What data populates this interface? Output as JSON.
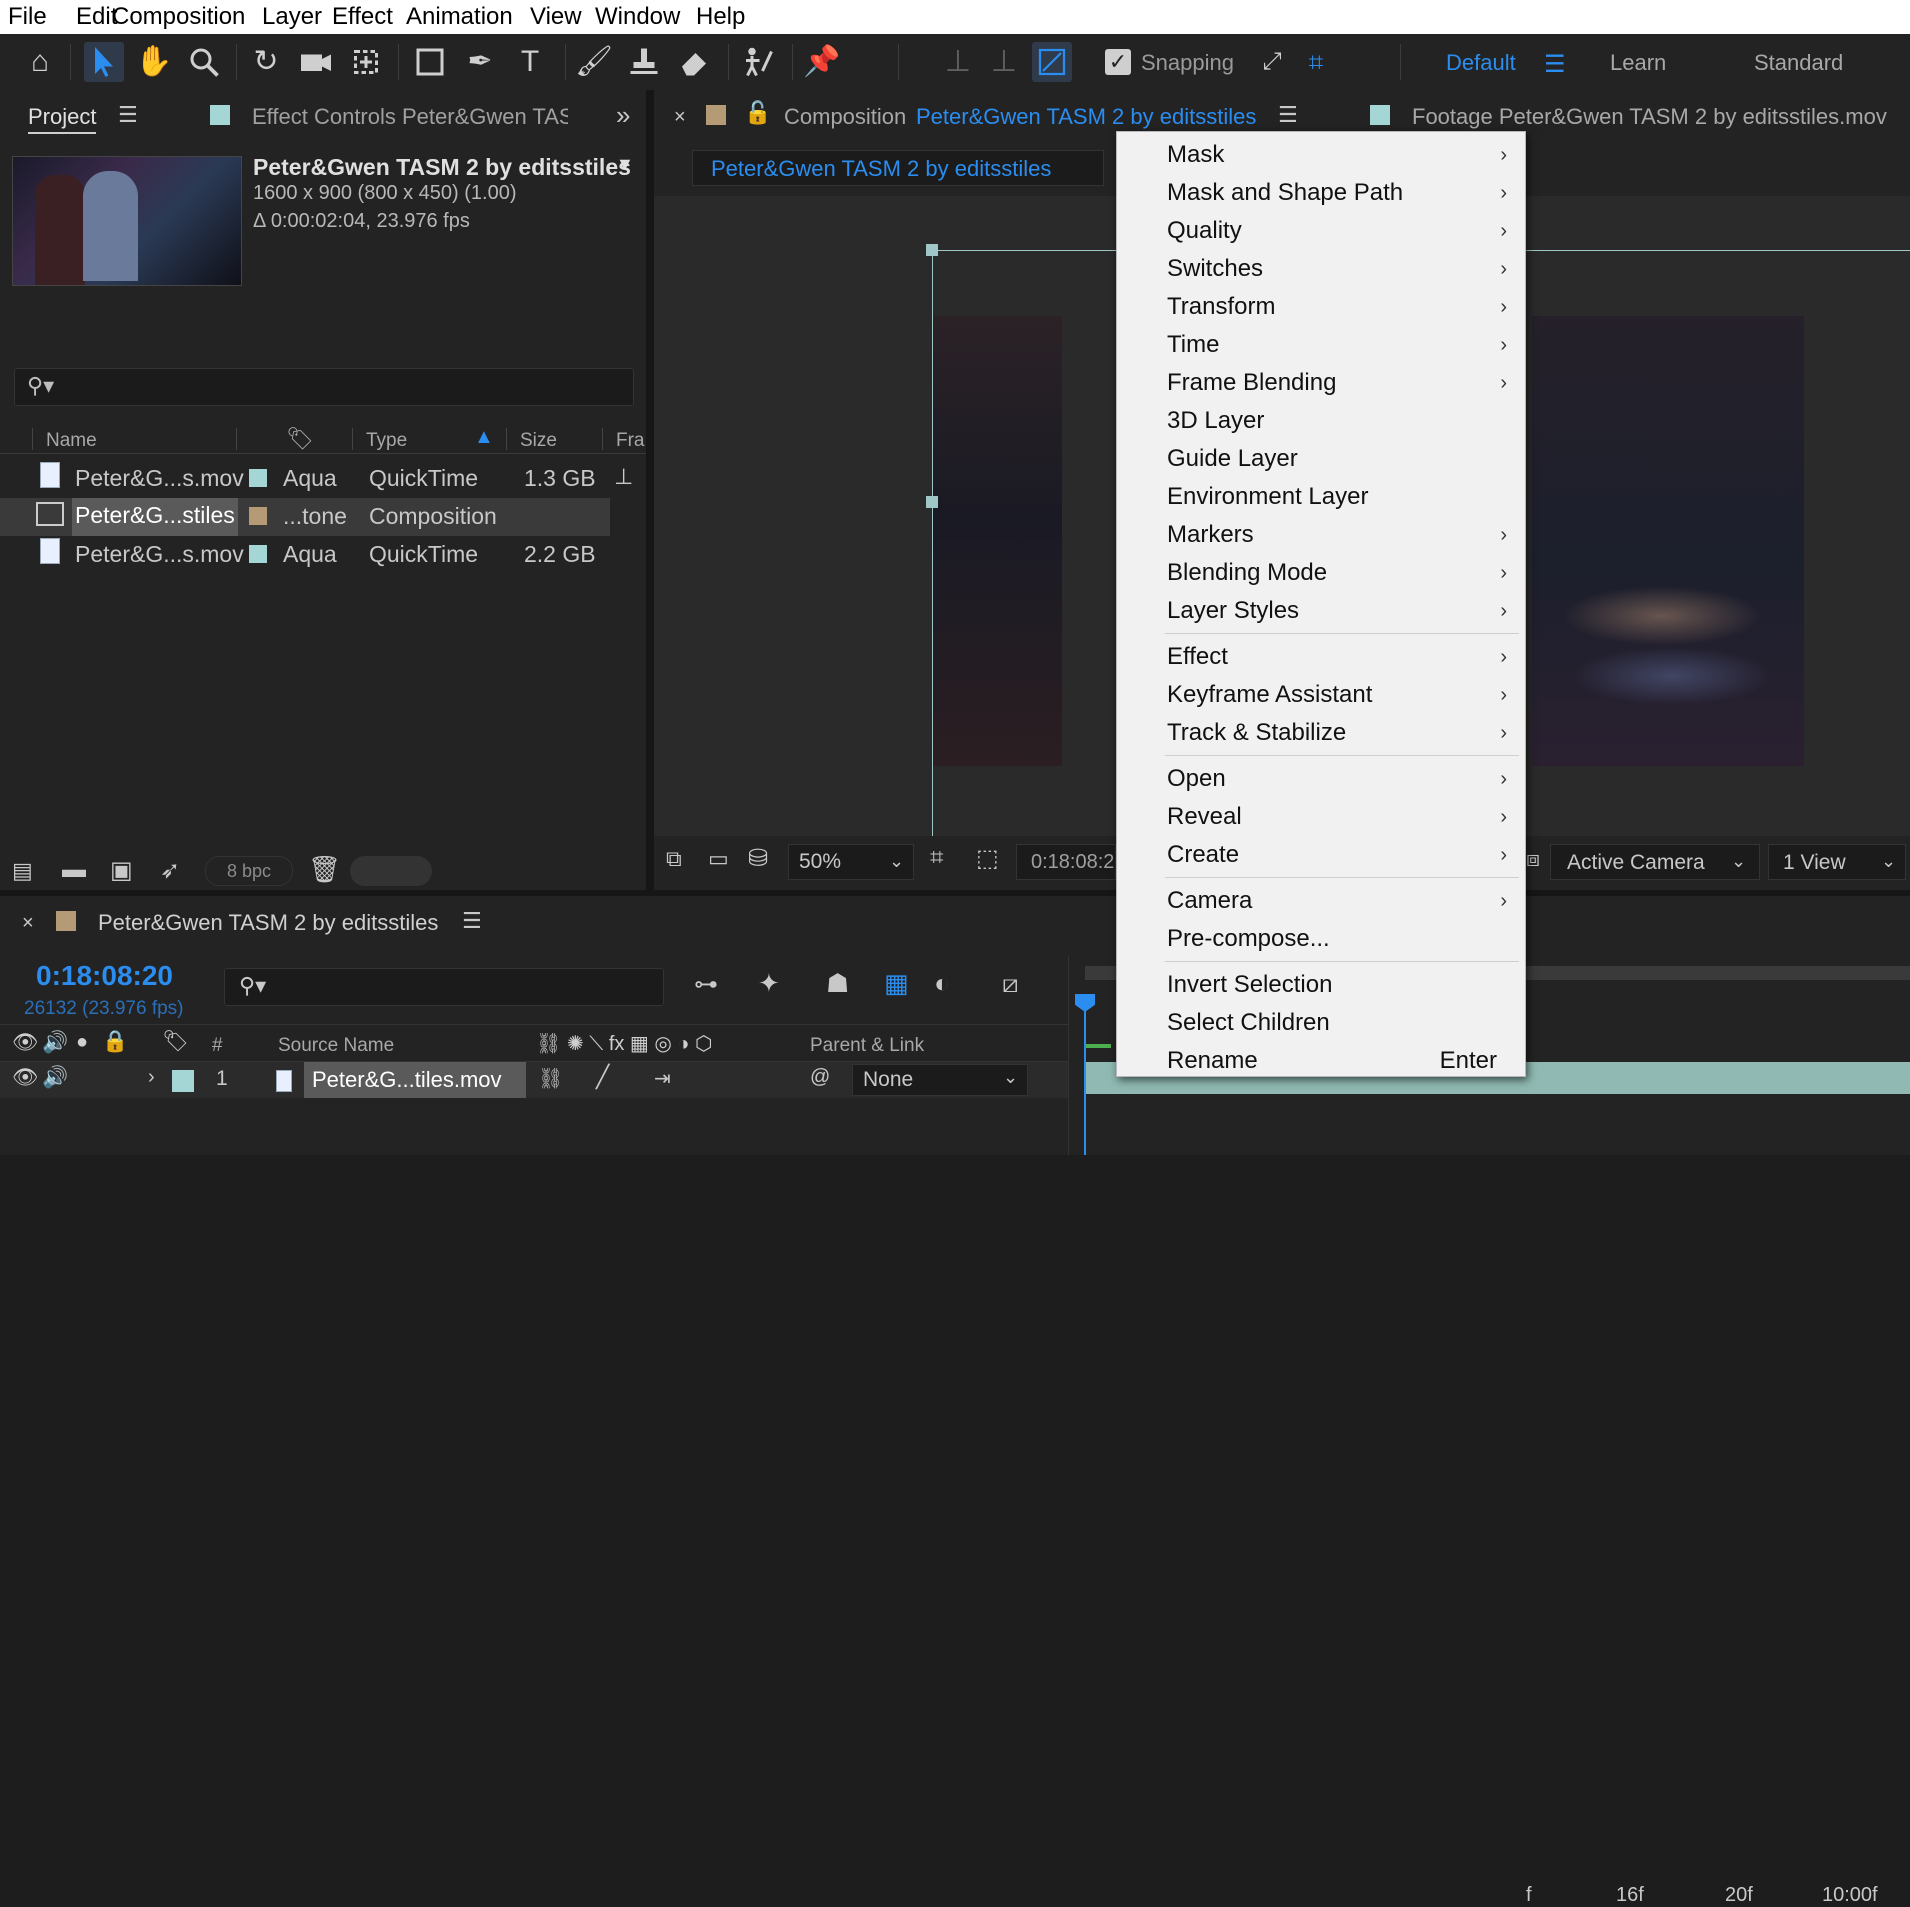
{
  "menubar": {
    "items": [
      "File",
      "Edit",
      "Composition",
      "Layer",
      "Effect",
      "Animation",
      "View",
      "Window",
      "Help"
    ]
  },
  "toolbar": {
    "snapping_label": "Snapping",
    "workspaces": [
      "Default",
      "Learn",
      "Standard"
    ]
  },
  "project": {
    "tab_label": "Project",
    "effect_controls_label": "Effect Controls  Peter&Gwen TAS",
    "item_name": "Peter&Gwen TASM 2 by editsstiles",
    "item_dims": "1600 x 900  (800 x 450) (1.00)",
    "item_duration": "Δ 0:00:02:04, 23.976 fps",
    "columns": {
      "name": "Name",
      "type": "Type",
      "size": "Size",
      "frame": "Fra"
    },
    "rows": [
      {
        "name": "Peter&G...s.mov",
        "label": "Aqua",
        "type": "QuickTime",
        "size": "1.3 GB",
        "color": "#a4d6d6"
      },
      {
        "name": "Peter&G...stiles",
        "label": "...tone",
        "type": "Composition",
        "size": "",
        "color": "#b59a76"
      },
      {
        "name": "Peter&G...s.mov",
        "label": "Aqua",
        "type": "QuickTime",
        "size": "2.2 GB",
        "color": "#a4d6d6"
      }
    ],
    "bpc": "8 bpc"
  },
  "composition": {
    "tab_prefix": "Composition",
    "tab_name": "Peter&Gwen TASM 2 by editsstiles",
    "breadcrumb": "Peter&Gwen TASM 2 by editsstiles",
    "zoom": "50%",
    "timecode": "0:18:08:2",
    "camera": "Active Camera",
    "view": "1 View"
  },
  "footage": {
    "tab_label": "Footage  Peter&Gwen TASM 2 by editsstiles.mov"
  },
  "context_menu": {
    "items": [
      {
        "label": "Mask",
        "sub": true
      },
      {
        "label": "Mask and Shape Path",
        "sub": true
      },
      {
        "label": "Quality",
        "sub": true
      },
      {
        "label": "Switches",
        "sub": true
      },
      {
        "label": "Transform",
        "sub": true
      },
      {
        "label": "Time",
        "sub": true
      },
      {
        "label": "Frame Blending",
        "sub": true
      },
      {
        "label": "3D Layer",
        "sub": false
      },
      {
        "label": "Guide Layer",
        "sub": false
      },
      {
        "label": "Environment Layer",
        "sub": false
      },
      {
        "label": "Markers",
        "sub": true
      },
      {
        "label": "Blending Mode",
        "sub": true
      },
      {
        "label": "Layer Styles",
        "sub": true
      },
      {
        "label": "Effect",
        "sub": true
      },
      {
        "label": "Keyframe Assistant",
        "sub": true
      },
      {
        "label": "Track & Stabilize",
        "sub": true
      },
      {
        "label": "Open",
        "sub": true
      },
      {
        "label": "Reveal",
        "sub": true
      },
      {
        "label": "Create",
        "sub": true
      },
      {
        "label": "Camera",
        "sub": true
      },
      {
        "label": "Pre-compose...",
        "sub": false
      },
      {
        "label": "Invert Selection",
        "sub": false
      },
      {
        "label": "Select Children",
        "sub": false
      },
      {
        "label": "Rename",
        "sub": false,
        "shortcut": "Enter"
      }
    ]
  },
  "timeline": {
    "tab_label": "Peter&Gwen TASM 2 by editsstiles",
    "timecode": "0:18:08:20",
    "frame_info": "26132 (23.976 fps)",
    "columns": {
      "hash": "#",
      "source_name": "Source Name",
      "parent": "Parent & Link"
    },
    "layer": {
      "index": "1",
      "name": "Peter&G...tiles.mov",
      "parent": "None"
    },
    "ruler": [
      "f",
      "16f",
      "20f",
      "10:00f"
    ]
  }
}
